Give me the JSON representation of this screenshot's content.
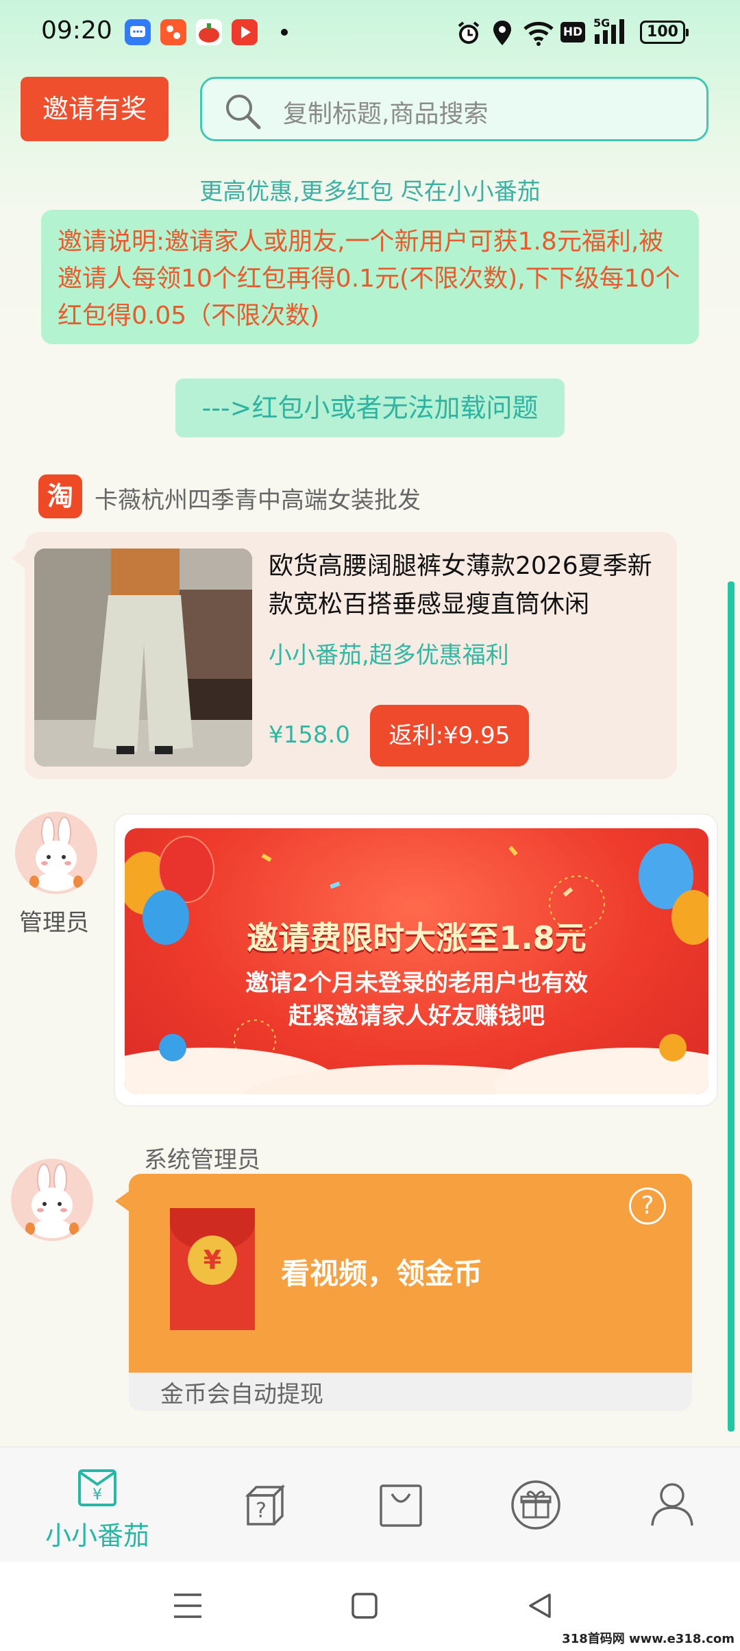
{
  "status_bar": {
    "time": "09:20",
    "battery": "100",
    "network": "5G",
    "hd": "HD"
  },
  "header": {
    "invite_label": "邀请有奖",
    "search_placeholder": "复制标题,商品搜索"
  },
  "tagline": "更高优惠,更多红包 尽在小小番茄",
  "notice": "邀请说明:邀请家人或朋友,一个新用户可获1.8元福利,被邀请人每领10个红包再得0.1元(不限次数),下下级每10个红包得0.05（不限次数)",
  "issue_link": "--->红包小或者无法加载问题",
  "shop": {
    "logo": "淘",
    "name": "卡薇杭州四季青中高端女装批发"
  },
  "product": {
    "title": "欧货高腰阔腿裤女薄款2026夏季新款宽松百搭垂感显瘦直筒休闲",
    "slogan": "小小番茄,超多优惠福利",
    "price": "¥158.0",
    "rebate": "返利:¥9.95"
  },
  "admin_post": {
    "sender": "管理员",
    "banner_title": "邀请费限时大涨至1.8元",
    "banner_line1": "邀请2个月未登录的老用户也有效",
    "banner_line2": "赶紧邀请家人好友赚钱吧"
  },
  "reward_post": {
    "sender": "系统管理员",
    "coin_symbol": "¥",
    "text": "看视频，领金币",
    "footer": "金币会自动提现",
    "help": "?"
  },
  "bottom_nav": {
    "home_label": "小小番茄",
    "items": [
      "home-icon",
      "help-box-icon",
      "shopping-bag-icon",
      "gift-icon",
      "user-icon"
    ]
  },
  "watermark": "318首码网 www.e318.com",
  "colors": {
    "accent": "#27b8a5",
    "red": "#ef4a2b",
    "orange": "#f6a040"
  }
}
